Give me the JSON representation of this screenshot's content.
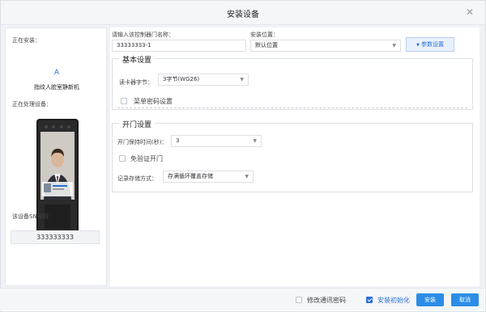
{
  "dialog": {
    "title": "安装设备"
  },
  "left": {
    "installing_label": "正在安装：",
    "link_letter": "A",
    "device_name": "指纹人脸室静新机",
    "processing_label": "正在处理设备：",
    "sn_label": "该设备SN号码：",
    "sn_value": "333333333"
  },
  "form": {
    "door_name_label": "请输入该控制器门名称：",
    "door_name_value": "33333333-1",
    "location_label": "安装位置：",
    "location_value": "默认位置",
    "param_button": "参数设置"
  },
  "basic": {
    "title": "基本设置",
    "card_reader_label": "读卡器字节：",
    "card_reader_value": "3字节(WG26)",
    "menu_password_label": "菜单密码设置"
  },
  "door": {
    "title": "开门设置",
    "hold_time_label": "开门保持时间(秒)：",
    "hold_time_value": "3",
    "no_verify_label": "免验证开门",
    "storage_label": "记录存储方式：",
    "storage_value": "存满循环覆盖存储"
  },
  "footer": {
    "modify_password_label": "修改通讯密码",
    "init_label": "安装初始化",
    "install_button": "安装",
    "cancel_button": "取消"
  },
  "colors": {
    "accent": "#2b8de6",
    "link": "#2b6fd6"
  }
}
